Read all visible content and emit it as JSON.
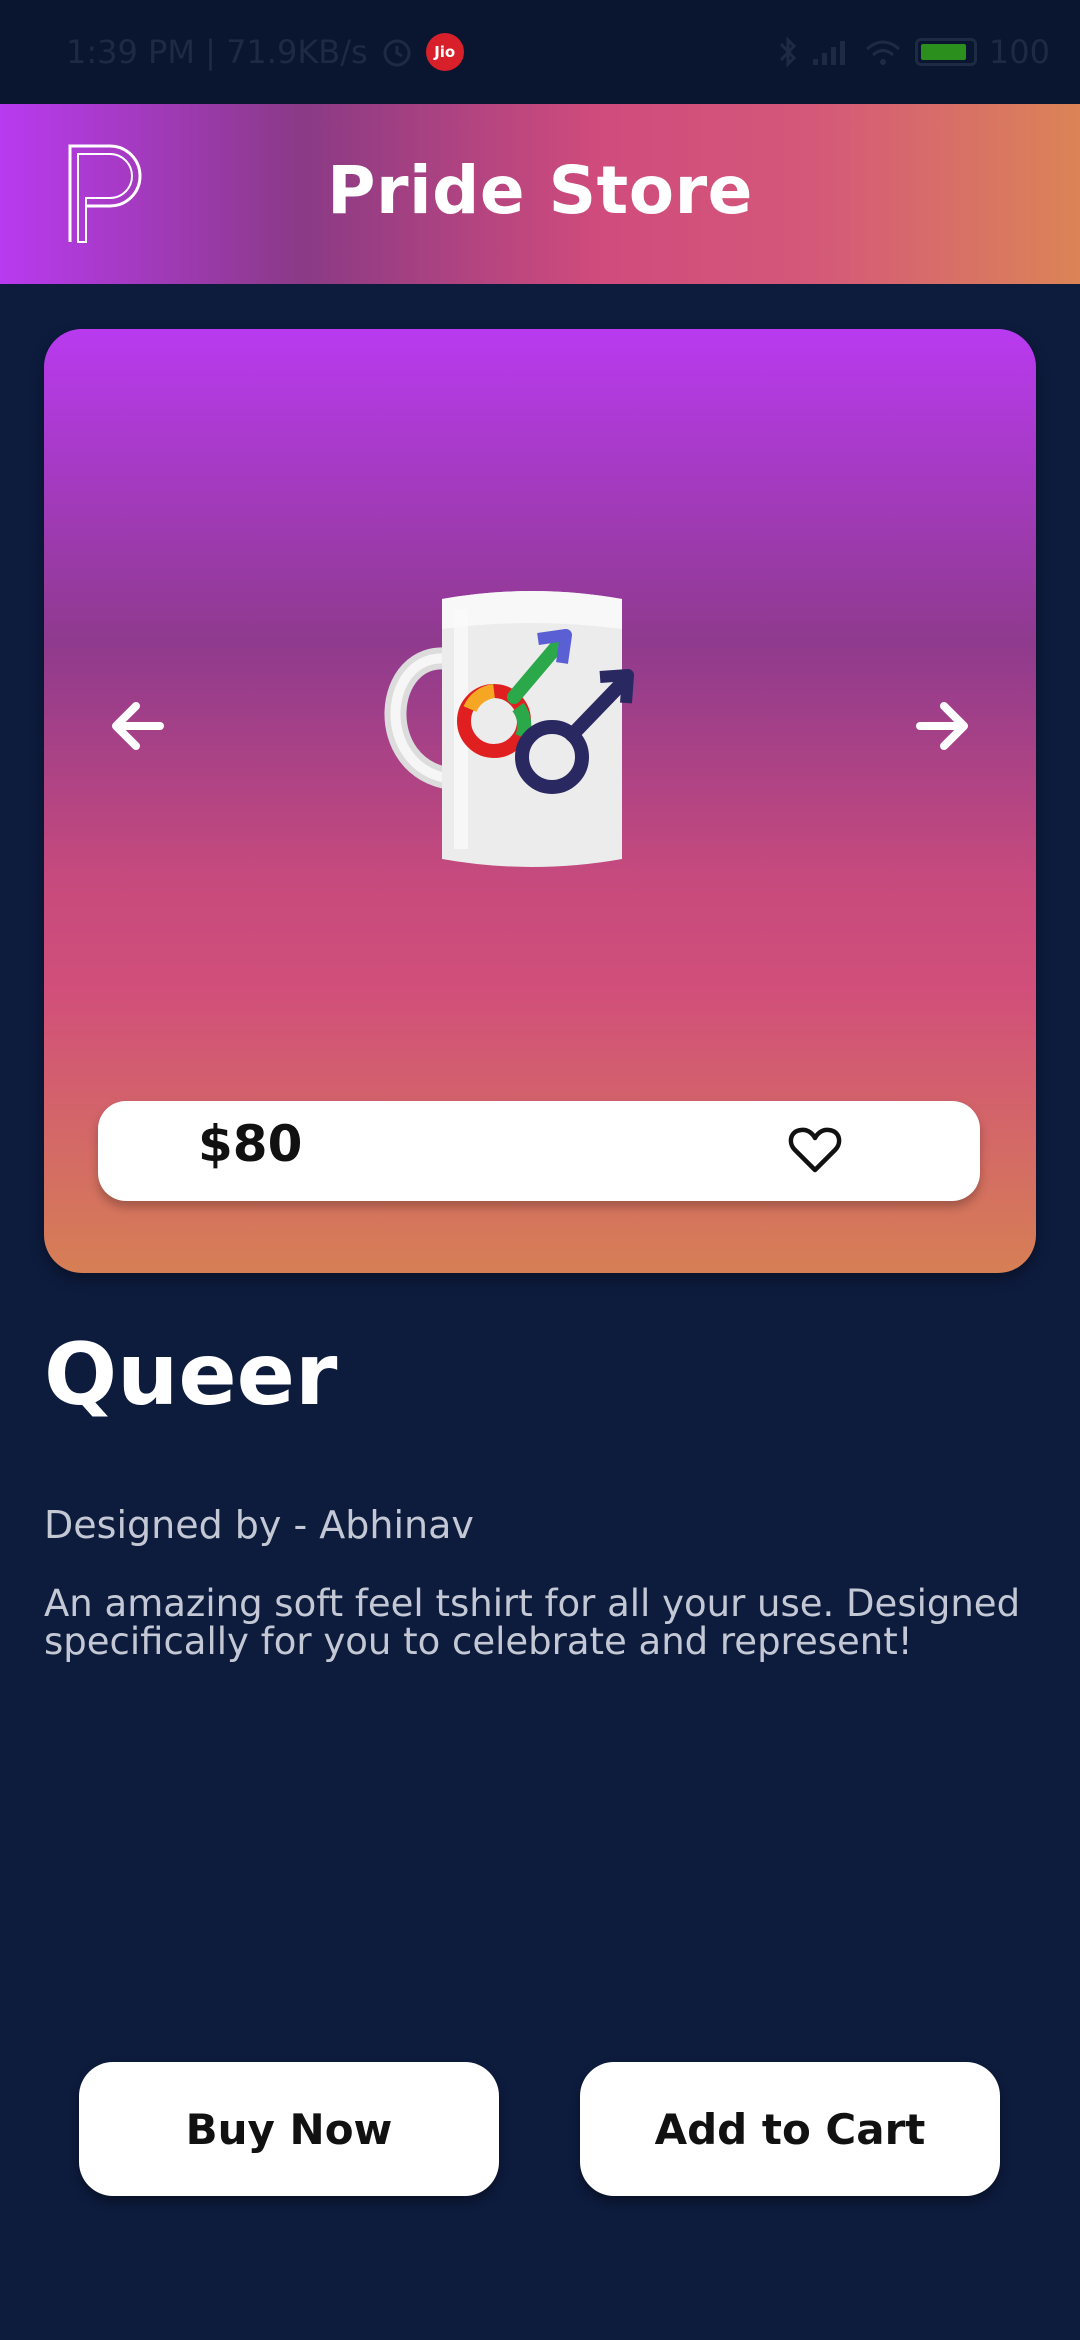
{
  "status_bar": {
    "time_speed": "1:39 PM | 71.9KB/s",
    "carrier_badge": "Jio",
    "battery": "100"
  },
  "header": {
    "title": "Pride Store",
    "logo_icon": "p-logo-icon"
  },
  "product": {
    "image_icon": "rainbow-male-symbols-mug",
    "price": "$80",
    "name": "Queer",
    "designer": "Designed by - Abhinav",
    "description": "An amazing soft feel tshirt for all your use. Designed specifically for you to celebrate and represent!"
  },
  "actions": {
    "buy_now": "Buy Now",
    "add_to_cart": "Add to Cart"
  },
  "colors": {
    "background": "#0d1b3d",
    "gradient_start": "#b93af0",
    "gradient_mid": "#cf4b7c",
    "gradient_end": "#db8456",
    "button_bg": "#ffffff"
  }
}
